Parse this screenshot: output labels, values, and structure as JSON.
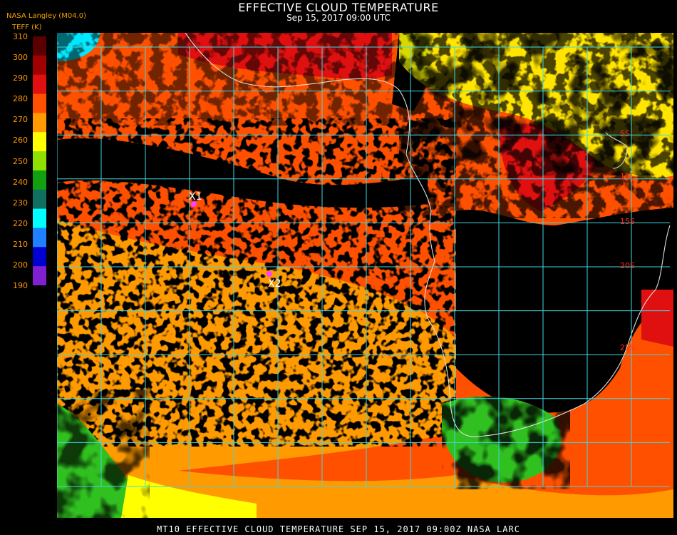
{
  "header": {
    "title": "EFFECTIVE CLOUD TEMPERATURE",
    "subtitle": "Sep 15, 2017 09:00 UTC",
    "credit": "NASA Langley (M04.0)",
    "unit_label": "TEFF (K)"
  },
  "colorbar": {
    "ticks": [
      "310",
      "300",
      "290",
      "280",
      "270",
      "260",
      "250",
      "240",
      "230",
      "220",
      "210",
      "200",
      "190"
    ],
    "colors": [
      "#5a0000",
      "#a00000",
      "#e01010",
      "#ff5000",
      "#ff9a00",
      "#ffff00",
      "#90e000",
      "#10a010",
      "#107060",
      "#00ffff",
      "#2080ff",
      "#0000d0",
      "#8020d0"
    ]
  },
  "map": {
    "grid_color": "#40d8e0",
    "coast_color": "#e0e0e0",
    "lat_labels": [
      "5S",
      "10S",
      "15S",
      "20S",
      "25S"
    ],
    "markers": [
      {
        "label": "X1",
        "color": "#ff40ff"
      },
      {
        "label": "X2",
        "color": "#ff40ff"
      }
    ],
    "palette": {
      "clear": "#000000",
      "warm_orange": "#ff5000",
      "light_orange": "#ff9a00",
      "red": "#e01010",
      "yellow": "#ffff00",
      "green": "#30c020",
      "teal": "#108070",
      "cyan": "#00e8ff"
    }
  },
  "footer": {
    "text": "MT10  EFFECTIVE CLOUD TEMPERATURE   SEP 15, 2017 09:00Z   NASA LARC"
  }
}
